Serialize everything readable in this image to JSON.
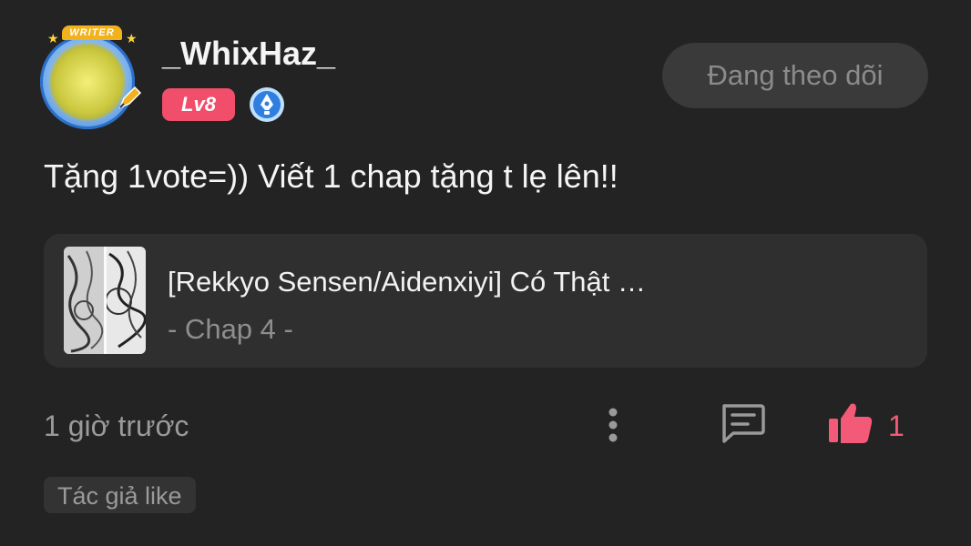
{
  "user": {
    "name": "_WhixHaz_",
    "level": "Lv8",
    "avatar_badge": "WRITER"
  },
  "follow_button": {
    "label": "Đang theo dõi"
  },
  "comment": {
    "text": "Tặng 1vote=)) Viết 1 chap tặng t lẹ lên!!"
  },
  "story": {
    "title": "[Rekkyo Sensen/Aidenxiyi] Có Thật …",
    "chapter": "- Chap 4 -"
  },
  "footer": {
    "timestamp": "1 giờ trước",
    "like_count": "1",
    "author_like": "Tác giả like"
  },
  "colors": {
    "background": "#232323",
    "accent_pink": "#f25a78",
    "level_badge": "#f04e6a",
    "card": "#2f2f2f"
  },
  "icons": [
    "more-vertical-icon",
    "reply-icon",
    "thumbs-up-icon",
    "pen-badge-icon"
  ]
}
